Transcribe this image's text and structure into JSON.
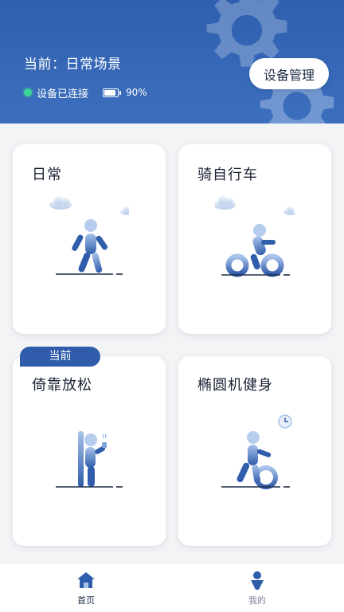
{
  "header": {
    "scene_label": "当前：日常场景",
    "connection_status": "设备已连接",
    "battery_text": "90%",
    "battery_level": 0.9,
    "device_button_label": "设备管理"
  },
  "cards": [
    {
      "title": "日常",
      "icon": "walking-figure-icon"
    },
    {
      "title": "骑自行车",
      "icon": "cycling-figure-icon"
    },
    {
      "title": "倚靠放松",
      "icon": "leaning-figure-icon",
      "badge": "当前"
    },
    {
      "title": "椭圆机健身",
      "icon": "elliptical-figure-icon"
    }
  ],
  "bottom_nav": {
    "items": [
      {
        "label": "首页",
        "icon": "home-icon",
        "active": true
      },
      {
        "label": "我的",
        "icon": "profile-icon",
        "active": false
      }
    ]
  },
  "colors": {
    "header": "#2f5fae",
    "accent": "#2f5cab",
    "connected_dot": "#3ed598"
  }
}
